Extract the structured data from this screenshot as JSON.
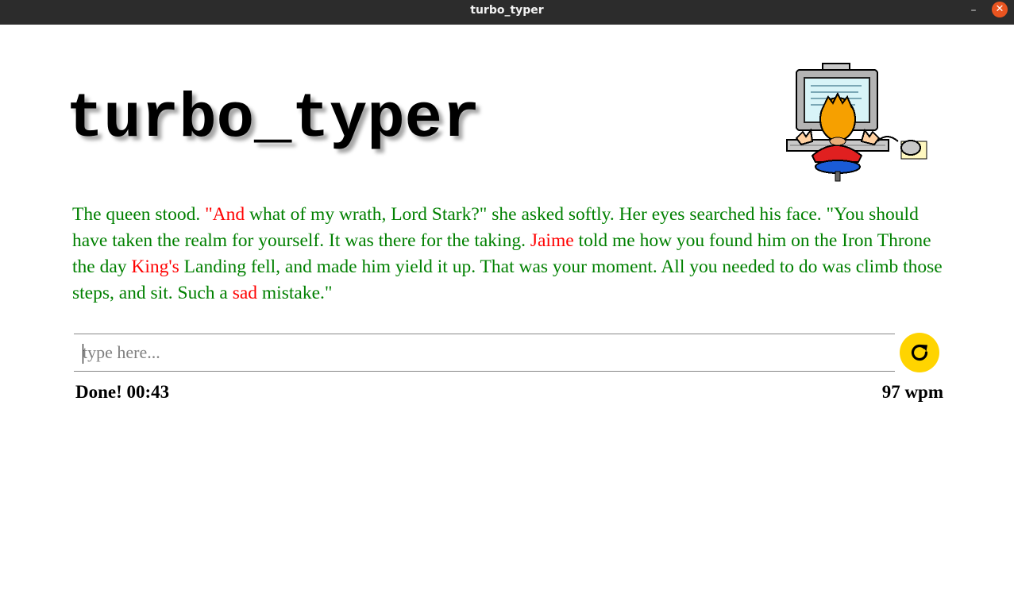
{
  "window": {
    "title": "turbo_typer",
    "minimize_glyph": "–",
    "close_glyph": "✕"
  },
  "header": {
    "title": "turbo_typer",
    "mascot_icon": "computer-user-icon"
  },
  "passage": {
    "segments": [
      {
        "text": "The queen stood. ",
        "status": "correct"
      },
      {
        "text": "\"And",
        "status": "incorrect"
      },
      {
        "text": " what of my wrath, Lord Stark?\" she asked softly. Her eyes searched his face. \"You should have taken the realm for yourself. It was there for the taking. ",
        "status": "correct"
      },
      {
        "text": "Jaime",
        "status": "incorrect"
      },
      {
        "text": " told me how you found him on the Iron Throne the day ",
        "status": "correct"
      },
      {
        "text": "King's",
        "status": "incorrect"
      },
      {
        "text": " Landing fell, and made him yield it up. That was your moment. All you needed to do was climb those steps, and sit. Such a ",
        "status": "correct"
      },
      {
        "text": "sad",
        "status": "incorrect"
      },
      {
        "text": " mistake.\"",
        "status": "correct"
      }
    ],
    "colors": {
      "correct": "#008000",
      "incorrect": "#ff0000"
    }
  },
  "input": {
    "value": "",
    "placeholder": "type here..."
  },
  "reset_button": {
    "icon": "refresh-icon",
    "color": "#ffd400"
  },
  "status": {
    "text": "Done! 00:43",
    "wpm": "97 wpm"
  }
}
